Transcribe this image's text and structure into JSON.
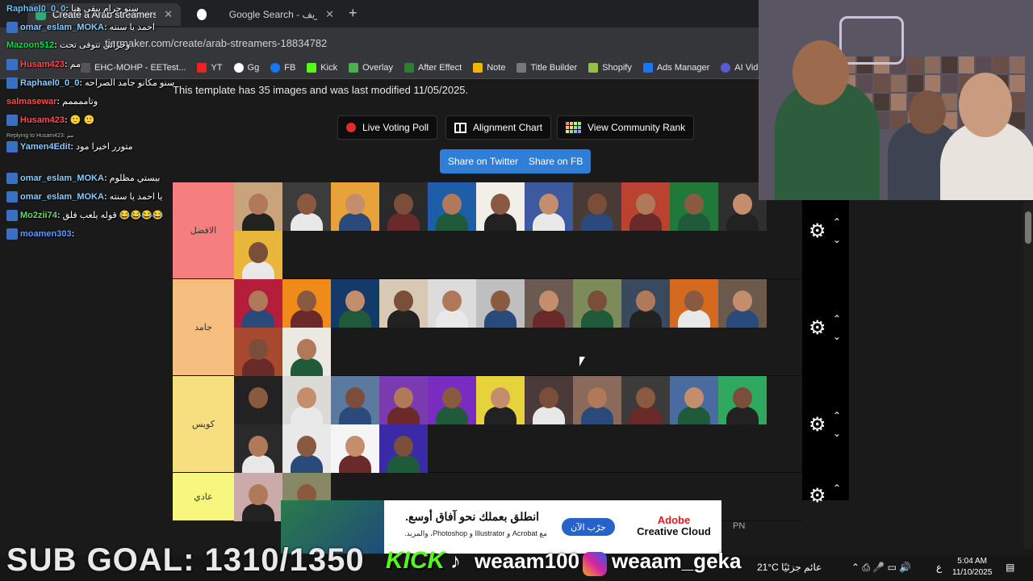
{
  "browser": {
    "tabs": [
      {
        "title": "Create a Arab streamers Tier Li",
        "active": true
      },
      {
        "title": "Google Search - عمرو شريف",
        "active": false
      }
    ],
    "url": "tiermaker.com/create/arab-streamers-18834782",
    "bookmarks": [
      "EHC-MOHP - EETest...",
      "YT",
      "Gg",
      "FB",
      "Kick",
      "Overlay",
      "After Effect",
      "Note",
      "Title Builder",
      "Shopify",
      "Ads Manager",
      "AI Video"
    ]
  },
  "page": {
    "info": "This template has 35 images and was last modified 11/05/2025.",
    "buttons": {
      "live_voting": "Live Voting Poll",
      "alignment": "Alignment Chart",
      "community": "View Community Rank",
      "twitter": "Share on Twitter",
      "facebook": "Share on FB"
    },
    "tiers": [
      {
        "label": "الافضل",
        "color": "#f57f7f",
        "count": 12
      },
      {
        "label": "جامد",
        "color": "#f6bf7f",
        "count": 13
      },
      {
        "label": "كويس",
        "color": "#f7df7f",
        "count": 15
      },
      {
        "label": "عادي",
        "color": "#f7f77f",
        "count": 2
      }
    ]
  },
  "chat": [
    {
      "user": "Raphael0_0_0",
      "text": "سنو حرام يبقى هنا"
    },
    {
      "user": "omar_eslam_MOKA",
      "text": "احمد يا سنته"
    },
    {
      "user": "Mazoon512",
      "text": "وجزاني تتوفى تحت"
    },
    {
      "user": "Husam423",
      "text": "مم"
    },
    {
      "user": "Raphael0_0_0",
      "text": "سنو مكانو جامد الصراحه"
    },
    {
      "user": "salmasewar",
      "text": "وتاممممم"
    },
    {
      "user": "Husam423",
      "text": "🙂 🙂"
    },
    {
      "user": "Yamen4Edit",
      "text": "متورر اخيرا مود"
    },
    {
      "user": "omar_eslam_MOKA",
      "text": "بيستي مظلوم"
    },
    {
      "user": "omar_eslam_MOKA",
      "text": "يا احمد يا سنته"
    },
    {
      "user": "Mo2zii74",
      "text": "قوله يلعب فلق 😂😂😂😂"
    },
    {
      "user": "moamen303",
      "text": ""
    }
  ],
  "reply_note": "Replying to Husam423: مم",
  "ad": {
    "headline": "انطلق بعملك نحو آفاق أوسع.",
    "sub": "مع Acrobat و Illustrator و Photoshop، والمزيد.",
    "cta": "جرّب الآن",
    "brand_top": "Adobe",
    "brand_bottom": "Creative Cloud"
  },
  "overlay": {
    "sub_goal": "SUB GOAL: 1310/1350",
    "kick": "KICK",
    "handle1": "weaam100",
    "handle2": "weaam_geka",
    "pn": "PN"
  },
  "taskbar": {
    "weather": "21°C عائم جزئيًا",
    "time": "5:04 AM",
    "date": "11/10/2025",
    "lang": "ع"
  },
  "colors": {
    "twitter": "#2f7fd8",
    "kick": "#53fc18"
  }
}
